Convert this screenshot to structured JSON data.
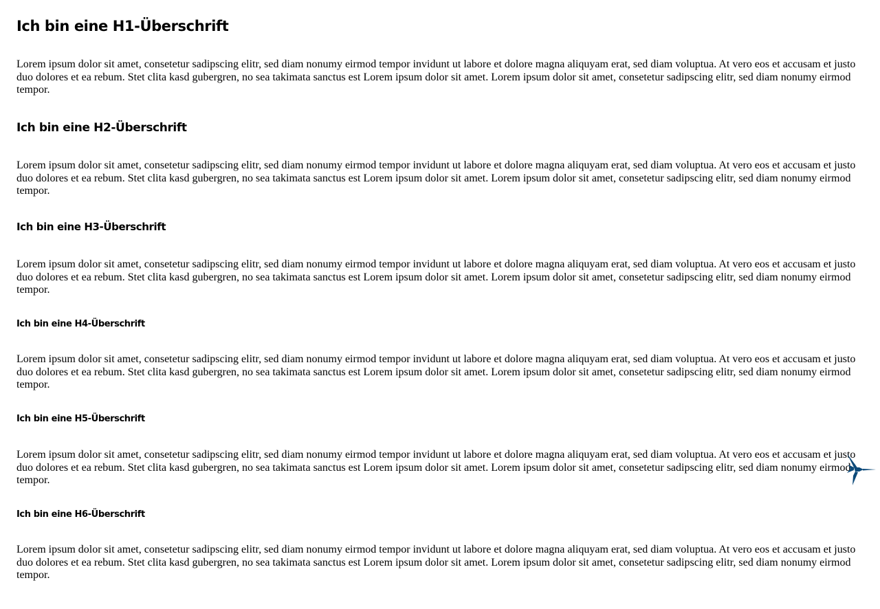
{
  "headings": {
    "h1": "Ich bin eine H1-Überschrift",
    "h2": "Ich bin eine H2-Überschrift",
    "h3": "Ich bin eine H3-Überschrift",
    "h4": "Ich bin eine H4-Überschrift",
    "h5": "Ich bin eine H5-Überschrift",
    "h6": "Ich bin eine H6-Überschrift"
  },
  "paragraphs": {
    "p1": "Lorem ipsum dolor sit amet, consetetur sadipscing elitr, sed diam nonumy eirmod tempor invidunt ut labore et dolore magna aliquyam erat, sed diam voluptua. At vero eos et accusam et justo duo dolores et ea rebum. Stet clita kasd gubergren, no sea takimata sanctus est Lorem ipsum dolor sit amet. Lorem ipsum dolor sit amet, consetetur sadipscing elitr, sed diam nonumy eirmod tempor.",
    "p2": "Lorem ipsum dolor sit amet, consetetur sadipscing elitr, sed diam nonumy eirmod tempor invidunt ut labore et dolore magna aliquyam erat, sed diam voluptua. At vero eos et accusam et justo duo dolores et ea rebum. Stet clita kasd gubergren, no sea takimata sanctus est Lorem ipsum dolor sit amet. Lorem ipsum dolor sit amet, consetetur sadipscing elitr, sed diam nonumy eirmod tempor.",
    "p3": "Lorem ipsum dolor sit amet, consetetur sadipscing elitr, sed diam nonumy eirmod tempor invidunt ut labore et dolore magna aliquyam erat, sed diam voluptua. At vero eos et accusam et justo duo dolores et ea rebum. Stet clita kasd gubergren, no sea takimata sanctus est Lorem ipsum dolor sit amet. Lorem ipsum dolor sit amet, consetetur sadipscing elitr, sed diam nonumy eirmod tempor.",
    "p4": "Lorem ipsum dolor sit amet, consetetur sadipscing elitr, sed diam nonumy eirmod tempor invidunt ut labore et dolore magna aliquyam erat, sed diam voluptua. At vero eos et accusam et justo duo dolores et ea rebum. Stet clita kasd gubergren, no sea takimata sanctus est Lorem ipsum dolor sit amet. Lorem ipsum dolor sit amet, consetetur sadipscing elitr, sed diam nonumy eirmod tempor.",
    "p5": "Lorem ipsum dolor sit amet, consetetur sadipscing elitr, sed diam nonumy eirmod tempor invidunt ut labore et dolore magna aliquyam erat, sed diam voluptua. At vero eos et accusam et justo duo dolores et ea rebum. Stet clita kasd gubergren, no sea takimata sanctus est Lorem ipsum dolor sit amet. Lorem ipsum dolor sit amet, consetetur sadipscing elitr, sed diam nonumy eirmod tempor.",
    "p6": "Lorem ipsum dolor sit amet, consetetur sadipscing elitr, sed diam nonumy eirmod tempor invidunt ut labore et dolore magna aliquyam erat, sed diam voluptua. At vero eos et accusam et justo duo dolores et ea rebum. Stet clita kasd gubergren, no sea takimata sanctus est Lorem ipsum dolor sit amet. Lorem ipsum dolor sit amet, consetetur sadipscing elitr, sed diam nonumy eirmod tempor."
  },
  "icons": {
    "floating": "hummingbird-icon"
  },
  "colors": {
    "text": "#000000",
    "background": "#ffffff",
    "icon": "#0d4a7a"
  }
}
